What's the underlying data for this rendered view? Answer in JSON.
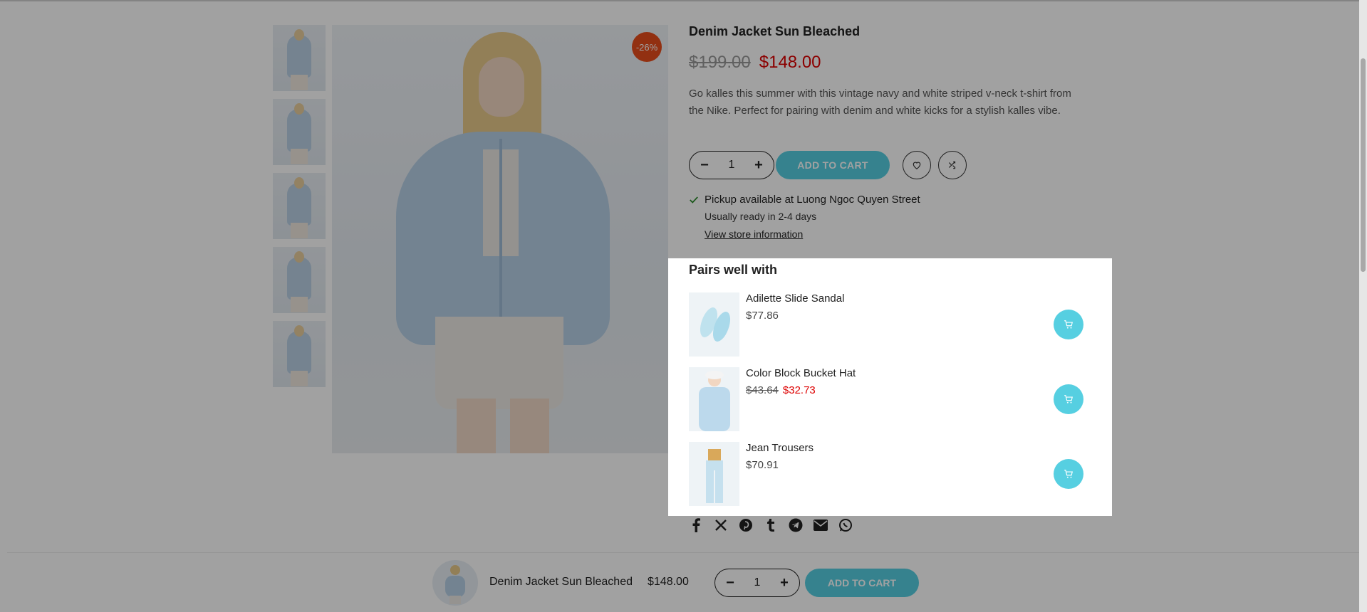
{
  "product": {
    "title": "Denim Jacket Sun Bleached",
    "price_old": "$199.00",
    "price_new": "$148.00",
    "sale_badge": "-26%",
    "description": "Go kalles this summer with this vintage navy and white striped v-neck t-shirt from the Nike. Perfect for pairing with denim and white kicks for a stylish kalles vibe.",
    "quantity": "1",
    "qty_minus": "−",
    "qty_plus": "+",
    "add_to_cart": "ADD TO CART"
  },
  "pickup": {
    "status": "Pickup available at Luong Ngoc Quyen Street",
    "ready": "Usually ready in 2-4 days",
    "link": "View store information"
  },
  "pairs": {
    "title": "Pairs well with",
    "items": [
      {
        "name": "Adilette Slide Sandal",
        "price": "$77.86",
        "price_old": "",
        "price_new": ""
      },
      {
        "name": "Color Block Bucket Hat",
        "price": "",
        "price_old": "$43.64",
        "price_new": "$32.73"
      },
      {
        "name": "Jean Trousers",
        "price": "$70.91",
        "price_old": "",
        "price_new": ""
      }
    ]
  },
  "share_icons": [
    "facebook-icon",
    "x-icon",
    "pinterest-icon",
    "tumblr-icon",
    "telegram-icon",
    "email-icon",
    "whatsapp-icon"
  ],
  "sticky": {
    "title": "Denim Jacket Sun Bleached",
    "price": "$148.00",
    "quantity": "1",
    "add_to_cart": "ADD TO CART"
  },
  "colors": {
    "accent": "#56cfe1",
    "sale_badge": "#e84d1b",
    "sale_price": "#dd0000"
  }
}
